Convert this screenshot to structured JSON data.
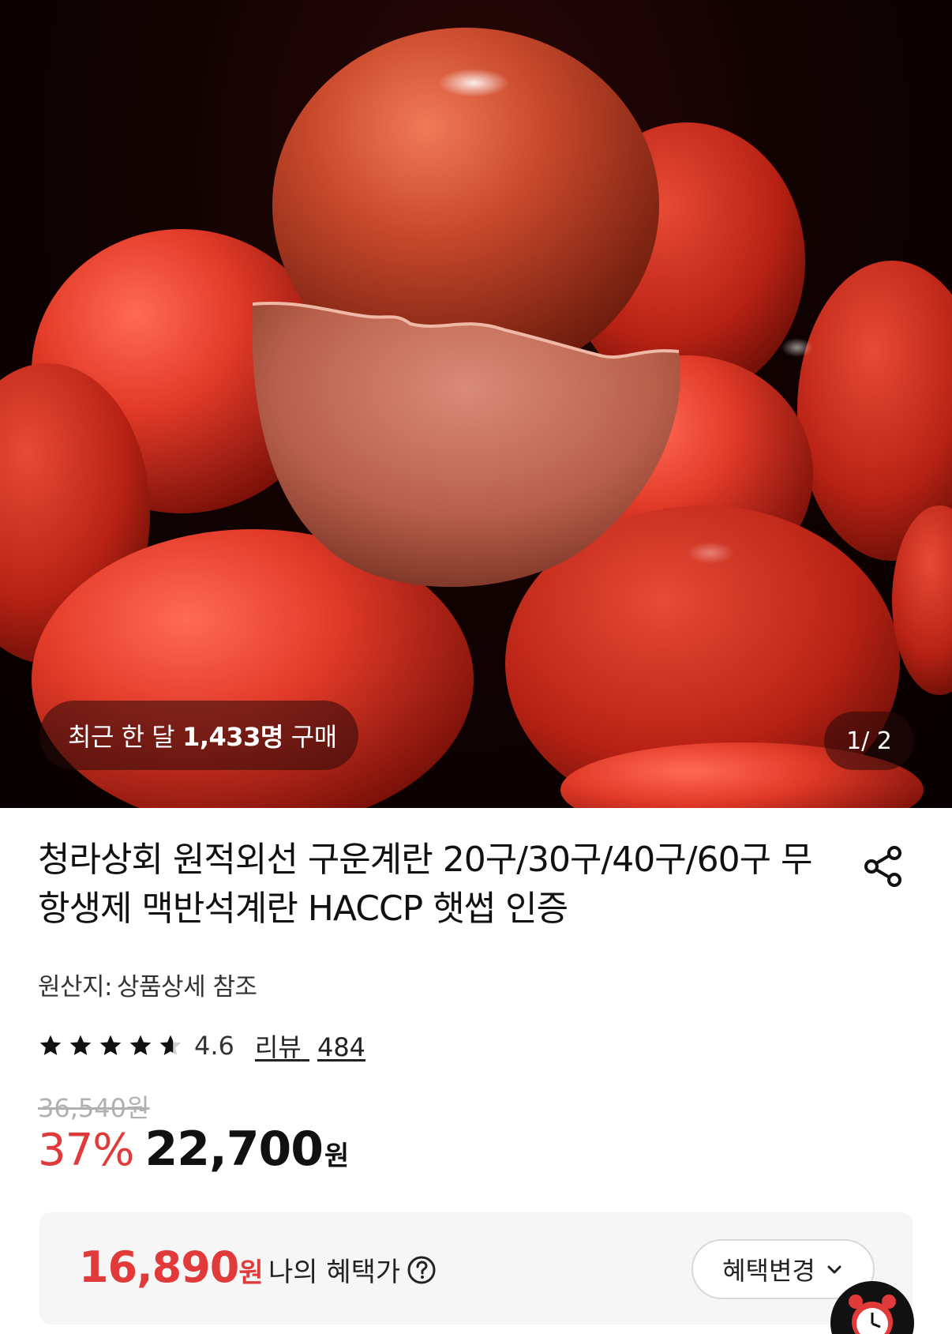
{
  "hero": {
    "image_alt": "red baked eggs",
    "buyers_prefix": "최근 한 달",
    "buyers_count": "1,433명",
    "buyers_suffix": "구매",
    "page_indicator": "1/ 2"
  },
  "product": {
    "title": "청라상회 원적외선 구운계란 20구/30구/40구/60구 무항생제 맥반석계란 HACCP 햇썹 인증",
    "origin_label": "원산지:",
    "origin_value": "상품상세 참조",
    "rating": "4.6",
    "rating_value": 4.6,
    "review_label": "리뷰",
    "review_count": "484",
    "original_price": "36,540원",
    "discount": "37%",
    "sale_price": "22,700",
    "sale_unit": "원"
  },
  "benefit": {
    "amount": "16,890",
    "unit": "원",
    "label": "나의 혜택가",
    "change_button": "혜택변경"
  },
  "icons": {
    "share": "share-icon",
    "help": "question-circle-icon",
    "chevron": "chevron-down-icon",
    "alarm": "alarm-clock-icon"
  },
  "colors": {
    "accent_red": "#e03a3a",
    "text": "#111111"
  }
}
